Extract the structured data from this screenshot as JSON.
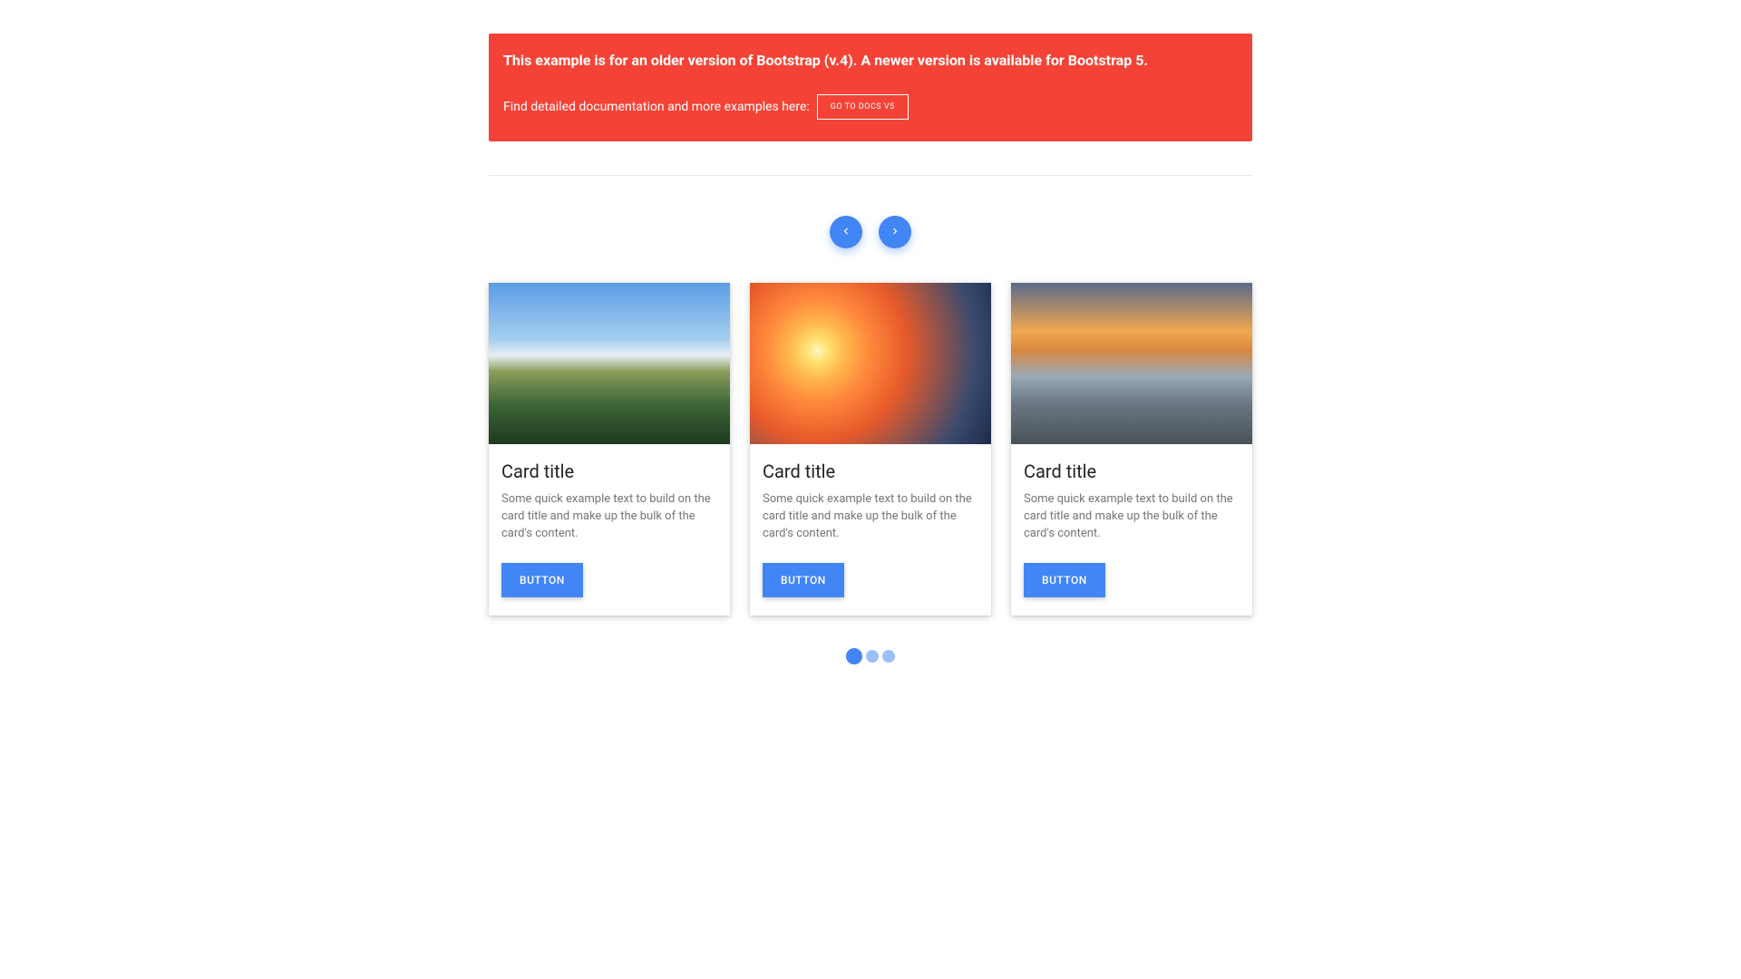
{
  "alert": {
    "title": "This example is for an older version of Bootstrap (v.4). A newer version is available for Bootstrap 5.",
    "text": "Find detailed documentation and more examples here:",
    "button": "GO TO DOCS V5"
  },
  "cards": [
    {
      "title": "Card title",
      "text": "Some quick example text to build on the card title and make up the bulk of the card's content.",
      "button": "BUTTON"
    },
    {
      "title": "Card title",
      "text": "Some quick example text to build on the card title and make up the bulk of the card's content.",
      "button": "BUTTON"
    },
    {
      "title": "Card title",
      "text": "Some quick example text to build on the card title and make up the bulk of the card's content.",
      "button": "BUTTON"
    }
  ],
  "carousel": {
    "active_index": 0,
    "total": 3
  }
}
